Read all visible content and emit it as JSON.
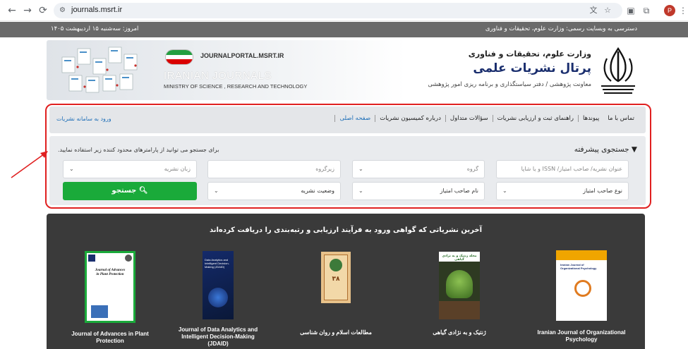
{
  "browser": {
    "url": "journals.msrt.ir",
    "profile_initial": "P"
  },
  "topbar": {
    "date": "امروز: سه‌شنبه ۱۵ اردیبهشت ۱۴۰۵",
    "official_access": "دسترسی به وبسایت رسمی: وزارت علوم، تحقیقات و فناوری"
  },
  "header": {
    "portal_url": "JOURNALPORTAL.MSRT.IR",
    "title_en": "IRANIAN JOURNALS",
    "subtitle_en": "MINISTRY OF SCIENCE , RESEARCH AND TECHNOLOGY",
    "ministry_fa": "وزارت علوم، تحقیقات و فناوری",
    "portal_fa": "پرتال نشریات علمی",
    "deputy_fa": "معاونت پژوهشی / دفتر سیاستگذاری و برنامه ریزی امور پژوهشی"
  },
  "nav": {
    "items": [
      "صفحه اصلی",
      "درباره کمیسیون نشریات",
      "سؤالات متداول",
      "راهنمای ثبت و ارزیابی نشریات",
      "پیوندها",
      "تماس با ما"
    ],
    "login": "ورود به سامانه نشریات"
  },
  "search": {
    "title": "جستجوی پیشرفته",
    "hint": "برای جستجو می توانید از پارامترهای محدود کننده زیر استفاده نمایید.",
    "fields": {
      "title_issn": "عنوان نشریه/ صاحب امتیاز/ ISSN و یا شاپا",
      "group": "گروه",
      "subgroup": "زیرگروه",
      "language": "زبان نشریه",
      "owner_type": "نوع صاحب امتیاز",
      "owner_name": "نام صاحب امتیاز",
      "status": "وضعیت نشریه"
    },
    "button": "جستجو"
  },
  "journals": {
    "heading": "آخرین نشریاتی که گواهی ورود به فرآیند ارزیابی و رتبه‌بندی را دریافت کرده‌اند",
    "items": [
      {
        "name": "Iranian Journal of Organizational Psychology",
        "cover_title": "Iranian Journal of Organizational Psychology"
      },
      {
        "name": "ژنتیک و به نژادی گیاهی",
        "cover_title": "مجله ژنتیک و به نژادی گیاهی"
      },
      {
        "name": "مطالعات اسلام و روان شناسی",
        "cover_title": "۳۸"
      },
      {
        "name": "Journal of Data Analytics and Intelligent Decision-Making (JDAID)",
        "cover_title": "Data Analytics and Intelligent Decision-Making (JDAID)"
      },
      {
        "name": "Journal of Advances in Plant Protection",
        "cover_title": "Journal of Advances in Plant Protection"
      }
    ]
  }
}
